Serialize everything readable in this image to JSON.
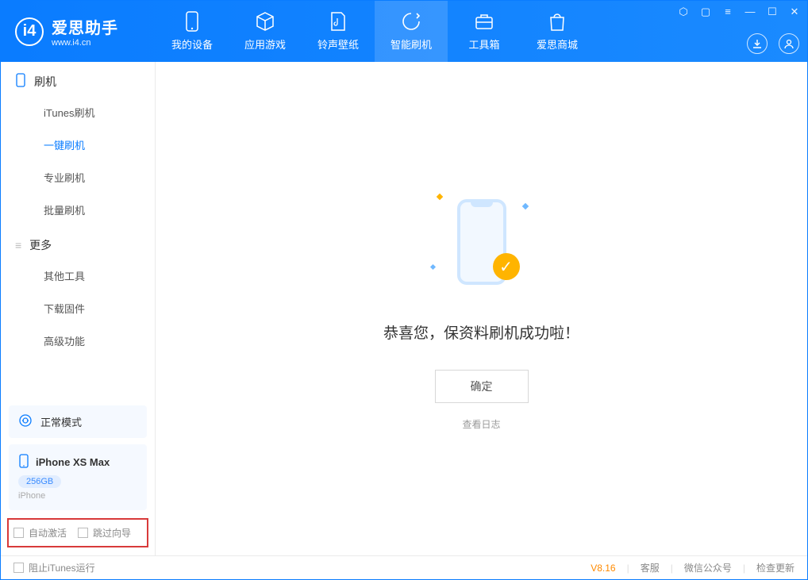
{
  "app": {
    "title": "爱思助手",
    "subtitle": "www.i4.cn"
  },
  "tabs": {
    "device": "我的设备",
    "apps": "应用游戏",
    "ringtone": "铃声壁纸",
    "flash": "智能刷机",
    "toolbox": "工具箱",
    "store": "爱思商城"
  },
  "sidebar": {
    "flash_header": "刷机",
    "items": {
      "itunes": "iTunes刷机",
      "oneclick": "一键刷机",
      "pro": "专业刷机",
      "batch": "批量刷机"
    },
    "more_header": "更多",
    "more_items": {
      "other": "其他工具",
      "firmware": "下载固件",
      "advanced": "高级功能"
    }
  },
  "device_status": {
    "mode": "正常模式"
  },
  "device": {
    "name": "iPhone XS Max",
    "capacity": "256GB",
    "type": "iPhone"
  },
  "options": {
    "auto_activate": "自动激活",
    "skip_guide": "跳过向导"
  },
  "main": {
    "success_message": "恭喜您，保资料刷机成功啦！",
    "ok": "确定",
    "view_log": "查看日志"
  },
  "statusbar": {
    "block_itunes": "阻止iTunes运行",
    "version": "V8.16",
    "support": "客服",
    "wechat": "微信公众号",
    "update": "检查更新"
  }
}
